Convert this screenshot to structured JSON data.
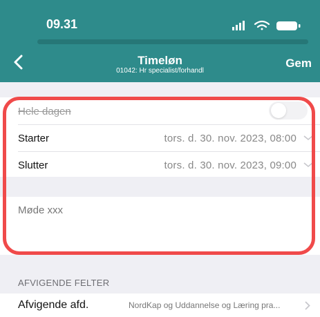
{
  "status": {
    "time": "09.31"
  },
  "nav": {
    "title": "Timeløn",
    "subtitle": "01042: Hr specialist/forhandl",
    "save_label": "Gem"
  },
  "form": {
    "all_day_label": "Hele dagen",
    "all_day_on": false,
    "start_label": "Starter",
    "start_value": "tors. d. 30. nov. 2023, 08:00",
    "end_label": "Slutter",
    "end_value": "tors. d. 30. nov. 2023, 09:00",
    "notes_placeholder": "Møde xxx"
  },
  "deviating": {
    "header": "AFVIGENDE FELTER",
    "dept_label": "Afvigende afd.",
    "dept_value": "NordKap og Uddannelse og Læring pra..."
  },
  "colors": {
    "accent": "#2e8b8b",
    "highlight": "#f04a4a"
  }
}
